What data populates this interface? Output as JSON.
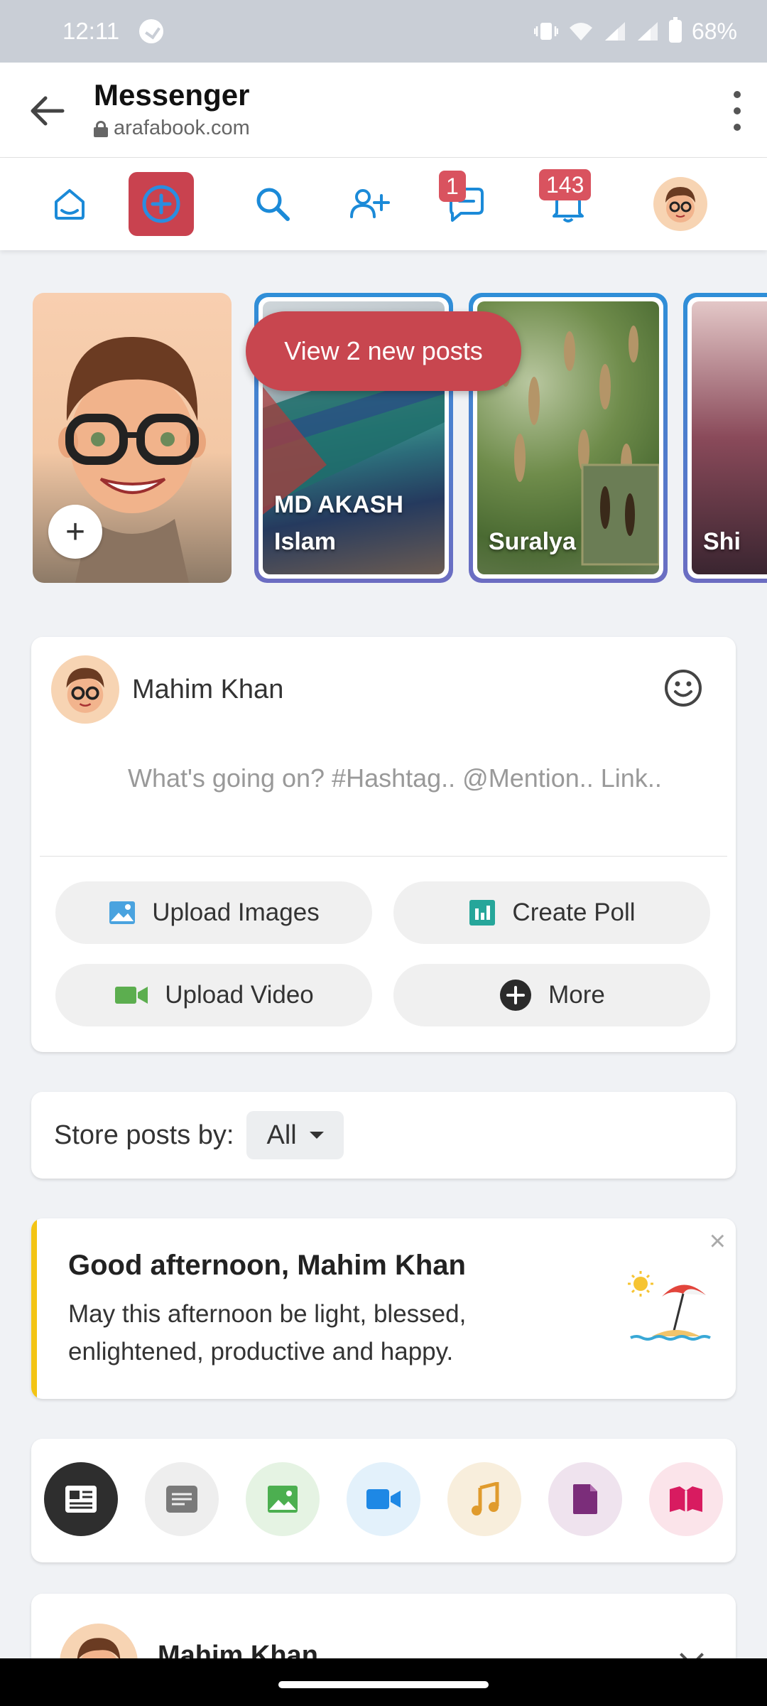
{
  "status_bar": {
    "time": "12:11",
    "battery": "68%"
  },
  "browser": {
    "title": "Messenger",
    "url": "arafabook.com"
  },
  "nav": {
    "messages_badge": "1",
    "notifications_badge": "143"
  },
  "stories": {
    "items": [
      {
        "name": "MD AKASH Islam"
      },
      {
        "name": "Suralya"
      },
      {
        "name": "Shi"
      }
    ],
    "new_posts_label": "View 2 new posts"
  },
  "composer": {
    "user_name": "Mahim Khan",
    "placeholder": "What's going on? #Hashtag.. @Mention.. Link..",
    "upload_images": "Upload Images",
    "create_poll": "Create Poll",
    "upload_video": "Upload Video",
    "more": "More"
  },
  "sort": {
    "label": "Store posts by:",
    "selected": "All"
  },
  "greeting": {
    "title": "Good afternoon, Mahim Khan",
    "body": "May this afternoon be light, blessed, enlightened, productive and happy.",
    "close": "×"
  },
  "post": {
    "author": "Mahim Khan"
  },
  "colors": {
    "accent": "#c9424f",
    "link_blue": "#1b8ad8",
    "greeting_bar": "#f3c414"
  }
}
